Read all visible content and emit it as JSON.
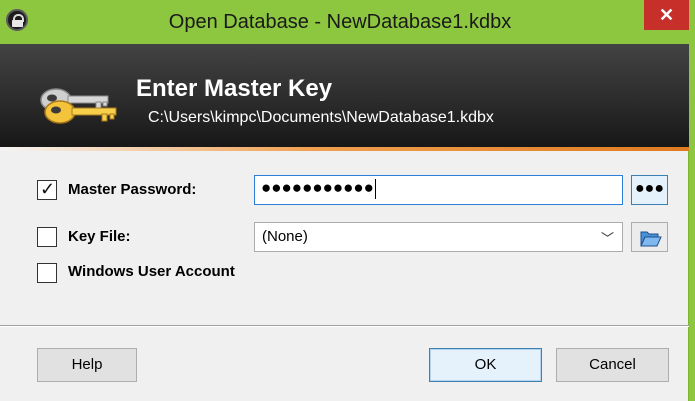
{
  "window": {
    "title": "Open Database - NewDatabase1.kdbx",
    "close_label": "✕"
  },
  "banner": {
    "title": "Enter Master Key",
    "path": "C:\\Users\\kimpc\\Documents\\NewDatabase1.kdbx"
  },
  "master_password": {
    "label": "Master Password:",
    "checked": true,
    "value": "●●●●●●●●●●●",
    "reveal_label": "●●●"
  },
  "key_file": {
    "label": "Key File:",
    "checked": false,
    "selected": "(None)"
  },
  "windows_account": {
    "label": "Windows User Account",
    "checked": false
  },
  "buttons": {
    "help": "Help",
    "ok": "OK",
    "cancel": "Cancel"
  },
  "colors": {
    "titlebar": "#8dc63f",
    "close": "#c7302a",
    "banner_dark": "#151515",
    "accent_orange": "#e07b20"
  }
}
